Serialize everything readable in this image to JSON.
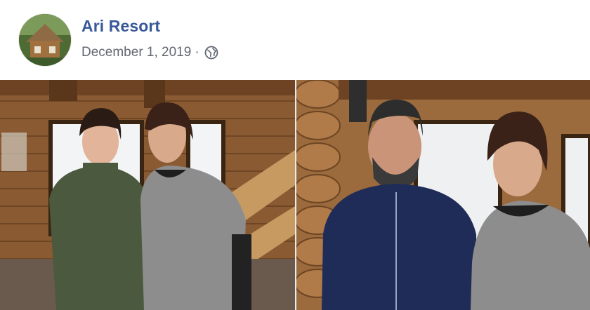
{
  "post": {
    "page_name": "Ari Resort",
    "date": "December 1, 2019",
    "separator": "·",
    "privacy_icon": "globe-icon",
    "avatar_icon": "resort-cabin-avatar"
  },
  "photos": [
    {
      "name": "left-photo",
      "description_icon": "photo"
    },
    {
      "name": "right-photo",
      "description_icon": "photo"
    }
  ],
  "colors": {
    "link": "#385898",
    "meta": "#606770",
    "wood": "#8a5a32"
  }
}
